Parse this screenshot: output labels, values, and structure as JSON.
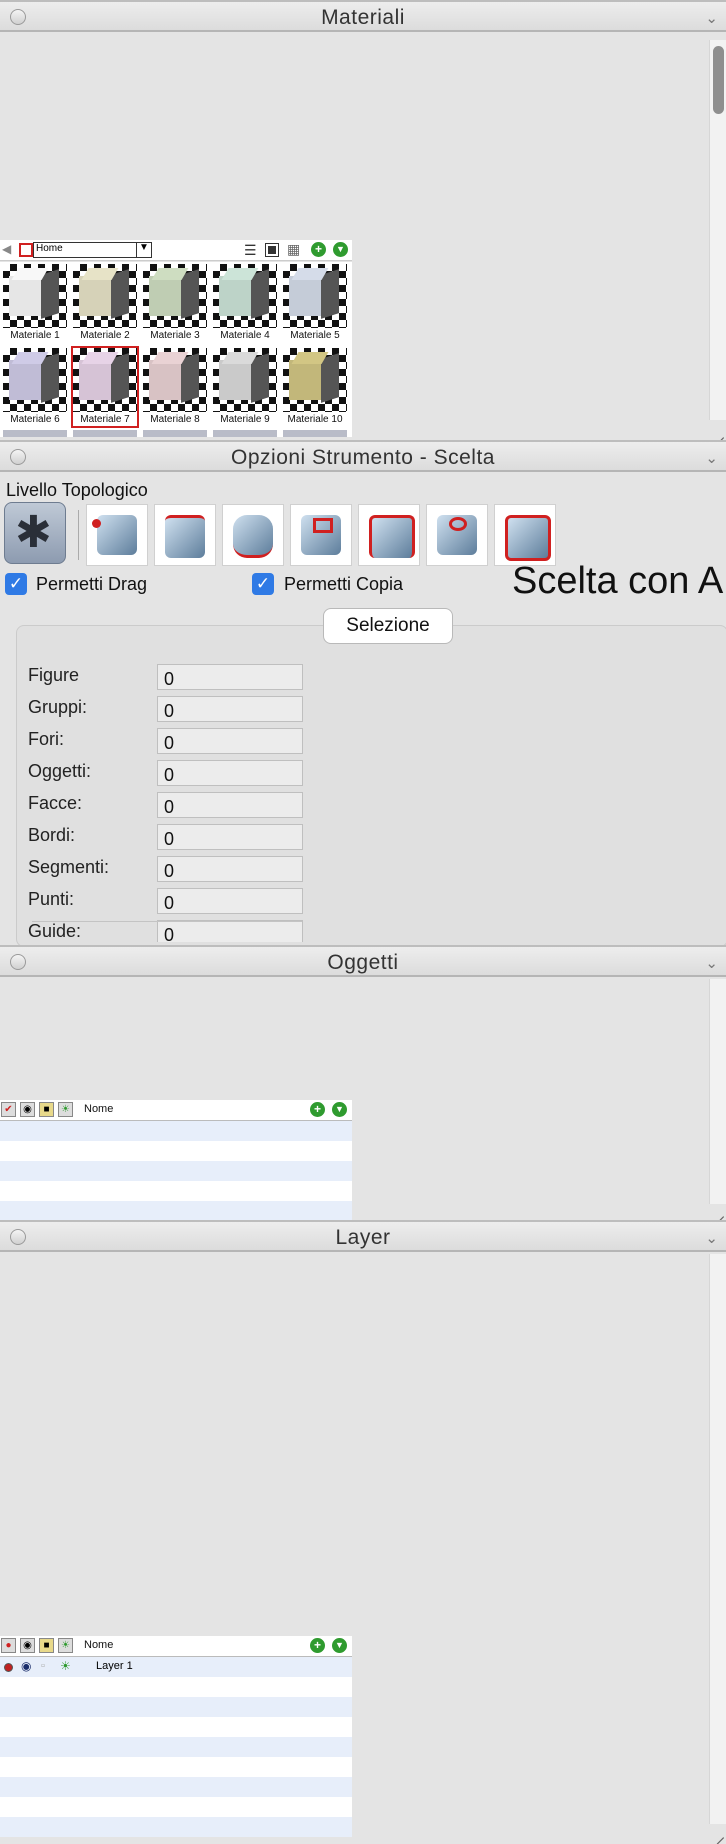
{
  "panels": {
    "materiali": {
      "title": "Materiali"
    },
    "opzioni": {
      "title": "Opzioni Strumento - Scelta"
    },
    "oggetti": {
      "title": "Oggetti"
    },
    "layer": {
      "title": "Layer"
    }
  },
  "materiali": {
    "folder": "Home",
    "selected": "Materiale 7",
    "items": [
      {
        "label": "Materiale 1",
        "color": "#e6e6e6"
      },
      {
        "label": "Materiale 2",
        "color": "#d6d2b8"
      },
      {
        "label": "Materiale 3",
        "color": "#bfcdb3"
      },
      {
        "label": "Materiale 4",
        "color": "#bdd3c8"
      },
      {
        "label": "Materiale 5",
        "color": "#c5ccd8"
      },
      {
        "label": "Materiale 6",
        "color": "#c0bcd6"
      },
      {
        "label": "Materiale 7",
        "color": "#d6c3d6"
      },
      {
        "label": "Materiale 8",
        "color": "#d8c2c4"
      },
      {
        "label": "Materiale 9",
        "color": "#cacaca"
      },
      {
        "label": "Materiale 10",
        "color": "#c2b77a"
      }
    ]
  },
  "opzioni": {
    "livello_label": "Livello Topologico",
    "permetti_drag": "Permetti Drag",
    "permetti_copia": "Permetti Copia",
    "scelta_text": "Scelta con A",
    "selezione_button": "Selezione",
    "stats": [
      {
        "label": "Figure",
        "value": "0"
      },
      {
        "label": "Gruppi:",
        "value": "0"
      },
      {
        "label": "Fori:",
        "value": "0"
      },
      {
        "label": "Oggetti:",
        "value": "0"
      },
      {
        "label": "Facce:",
        "value": "0"
      },
      {
        "label": "Bordi:",
        "value": "0"
      },
      {
        "label": "Segmenti:",
        "value": "0"
      },
      {
        "label": "Punti:",
        "value": "0"
      },
      {
        "label": "Guide:",
        "value": "0"
      }
    ]
  },
  "oggetti": {
    "column_name": "Nome"
  },
  "layer": {
    "column_name": "Nome",
    "rows": [
      {
        "name": "Layer 1"
      }
    ]
  },
  "colors": {
    "accent": "#2f7ae5",
    "selected_border": "#d02020",
    "add_button": "#2f9b2f"
  }
}
